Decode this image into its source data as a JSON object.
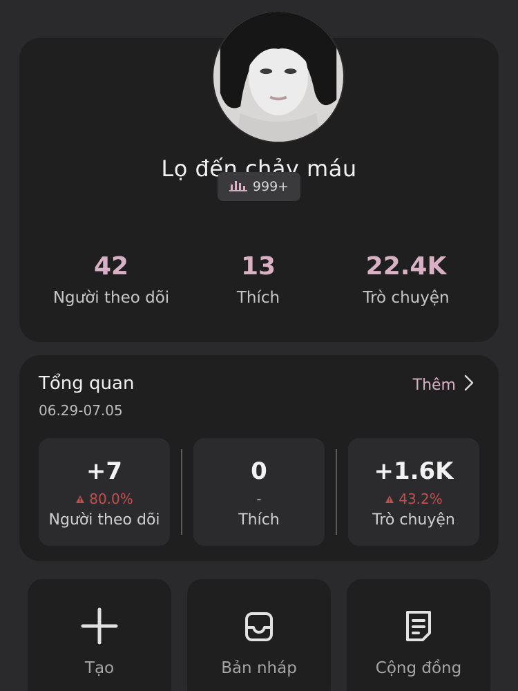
{
  "profile": {
    "name": "Lọ đến chảy máu",
    "rank_badge": "999+",
    "stats": [
      {
        "value": "42",
        "label": "Người theo dõi"
      },
      {
        "value": "13",
        "label": "Thích"
      },
      {
        "value": "22.4K",
        "label": "Trò chuyện"
      }
    ]
  },
  "overview": {
    "title": "Tổng quan",
    "date_range": "06.29-07.05",
    "more_label": "Thêm",
    "metrics": [
      {
        "value": "+7",
        "change": "80.0%",
        "label": "Người theo dõi"
      },
      {
        "value": "0",
        "change": "-",
        "label": "Thích"
      },
      {
        "value": "+1.6K",
        "change": "43.2%",
        "label": "Trò chuyện"
      }
    ]
  },
  "actions": [
    {
      "label": "Tạo",
      "icon": "plus-icon"
    },
    {
      "label": "Bản nháp",
      "icon": "drafts-tray-icon"
    },
    {
      "label": "Cộng đồng",
      "icon": "community-doc-icon"
    }
  ],
  "colors": {
    "background": "#2a2a2c",
    "card": "#1f1f20",
    "accent_pink": "#d8b1c4",
    "change_red": "#c0504d"
  }
}
